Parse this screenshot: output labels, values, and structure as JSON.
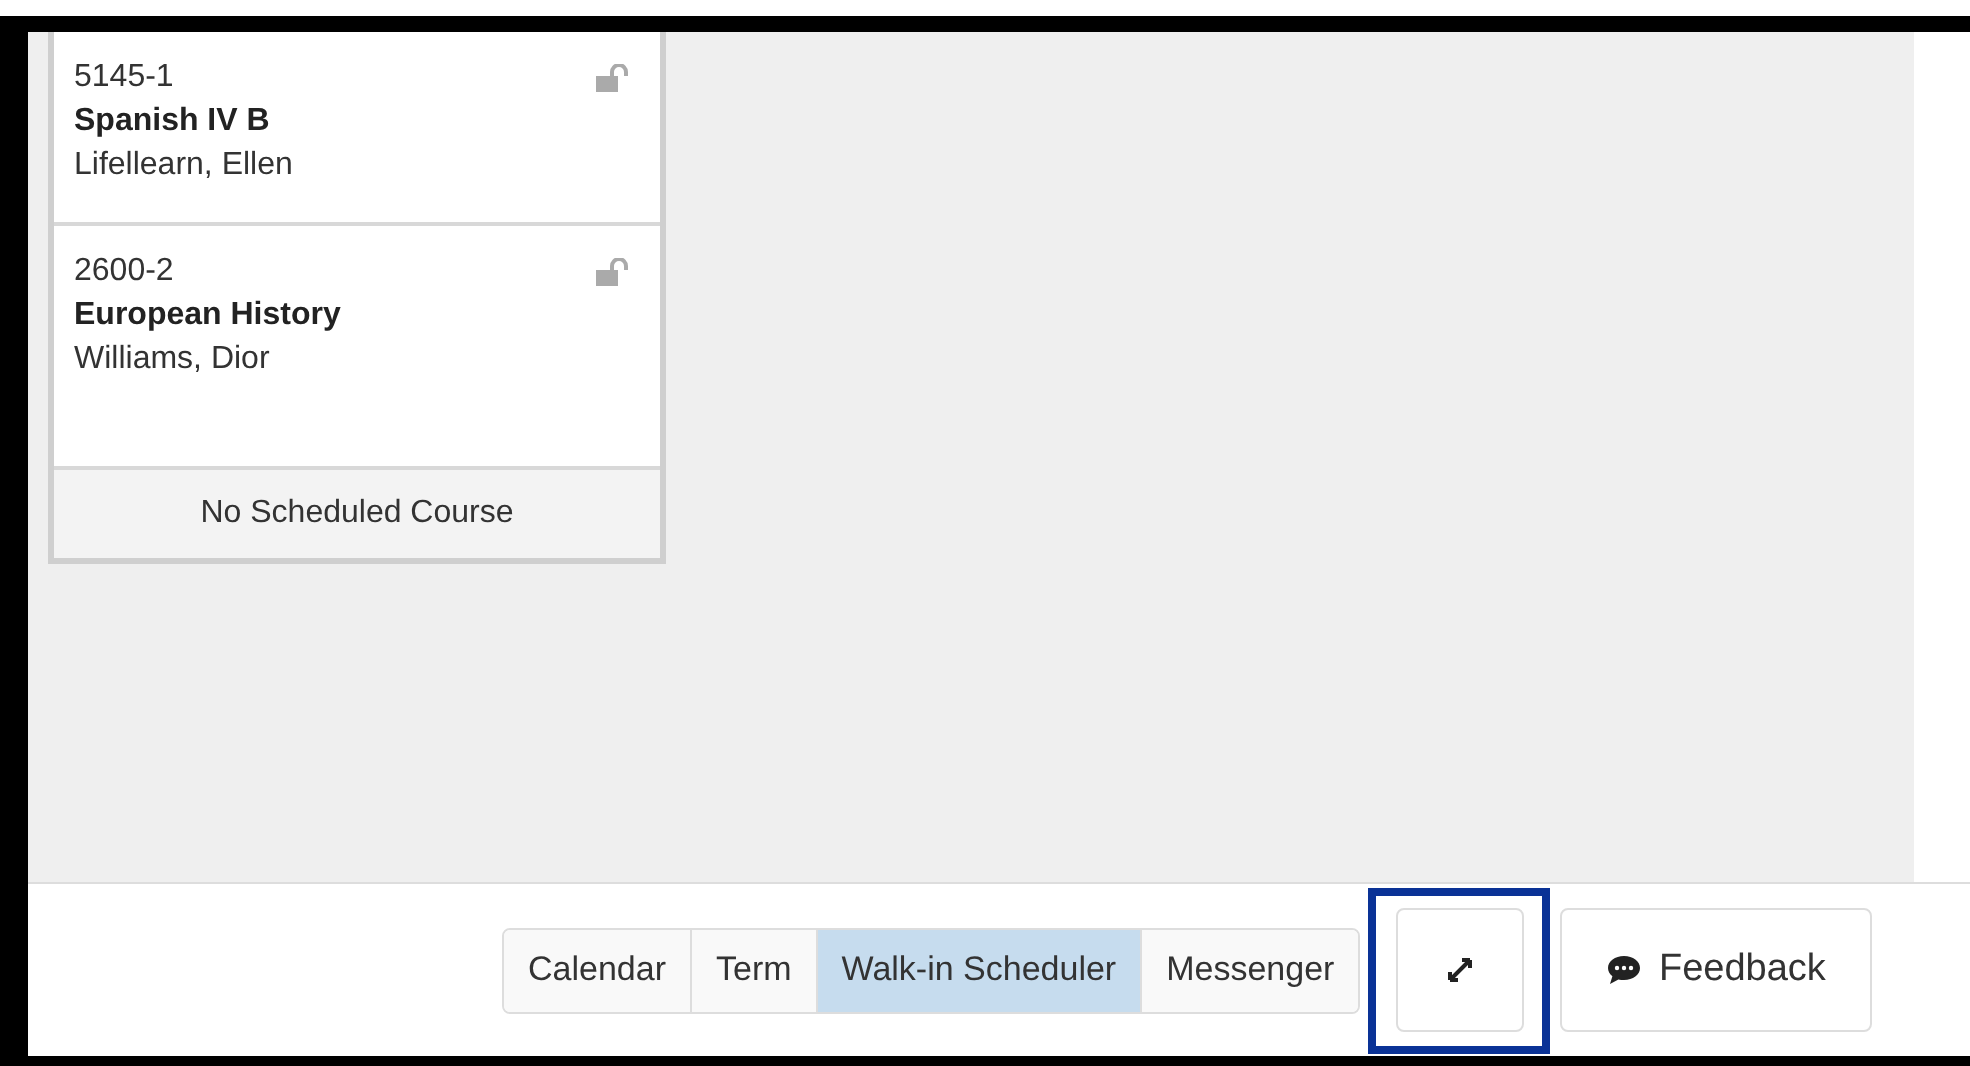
{
  "schedule": {
    "cards": [
      {
        "kind": "course",
        "code": "5145-1",
        "title": "Spanish IV B",
        "teacher": "Lifellearn, Ellen",
        "locked": false
      },
      {
        "kind": "course",
        "code": "2600-2",
        "title": "European History",
        "teacher": "Williams, Dior",
        "locked": false
      },
      {
        "kind": "empty",
        "label": "No Scheduled Course"
      }
    ]
  },
  "footer": {
    "tabs": [
      {
        "label": "Calendar",
        "selected": false
      },
      {
        "label": "Term",
        "selected": false
      },
      {
        "label": "Walk-in Scheduler",
        "selected": true
      },
      {
        "label": "Messenger",
        "selected": false
      }
    ],
    "expand_button": {
      "highlighted": true
    },
    "feedback_button": {
      "label": "Feedback"
    }
  }
}
